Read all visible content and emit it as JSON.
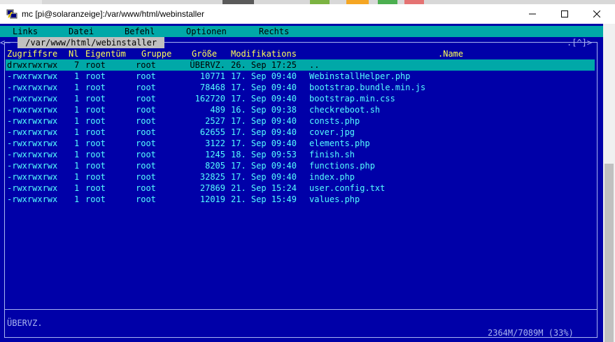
{
  "window": {
    "title": "mc [pi@solaranzeige]:/var/www/html/webinstaller"
  },
  "menu": [
    "Links",
    "Datei",
    "Befehl",
    "Optionen",
    "Rechts"
  ],
  "panel": {
    "path": " /var/www/html/webinstaller ",
    "corner_left": "<─",
    "corner_right": ".[^]>",
    "columns": {
      "perm": "Zugriffsre",
      "nl": "Nl",
      "owner": "Eigentüm",
      "group": "Gruppe",
      "size": "Größe",
      "mtime": "Modifikations",
      "name": ".Name"
    },
    "rows": [
      {
        "perm": "drwxrwxrwx",
        "nl": "7",
        "owner": "root",
        "group": "root",
        "size": "ÜBERVZ.",
        "mtime": "26. Sep 17:25",
        "name": ".."
      },
      {
        "perm": "-rwxrwxrwx",
        "nl": "1",
        "owner": "root",
        "group": "root",
        "size": "10771",
        "mtime": "17. Sep 09:40",
        "name": "WebinstallHelper.php"
      },
      {
        "perm": "-rwxrwxrwx",
        "nl": "1",
        "owner": "root",
        "group": "root",
        "size": "78468",
        "mtime": "17. Sep 09:40",
        "name": "bootstrap.bundle.min.js"
      },
      {
        "perm": "-rwxrwxrwx",
        "nl": "1",
        "owner": "root",
        "group": "root",
        "size": "162720",
        "mtime": "17. Sep 09:40",
        "name": "bootstrap.min.css"
      },
      {
        "perm": "-rwxrwxrwx",
        "nl": "1",
        "owner": "root",
        "group": "root",
        "size": "489",
        "mtime": "16. Sep 09:38",
        "name": "checkreboot.sh"
      },
      {
        "perm": "-rwxrwxrwx",
        "nl": "1",
        "owner": "root",
        "group": "root",
        "size": "2527",
        "mtime": "17. Sep 09:40",
        "name": "consts.php"
      },
      {
        "perm": "-rwxrwxrwx",
        "nl": "1",
        "owner": "root",
        "group": "root",
        "size": "62655",
        "mtime": "17. Sep 09:40",
        "name": "cover.jpg"
      },
      {
        "perm": "-rwxrwxrwx",
        "nl": "1",
        "owner": "root",
        "group": "root",
        "size": "3122",
        "mtime": "17. Sep 09:40",
        "name": "elements.php"
      },
      {
        "perm": "-rwxrwxrwx",
        "nl": "1",
        "owner": "root",
        "group": "root",
        "size": "1245",
        "mtime": "18. Sep 09:53",
        "name": "finish.sh"
      },
      {
        "perm": "-rwxrwxrwx",
        "nl": "1",
        "owner": "root",
        "group": "root",
        "size": "8205",
        "mtime": "17. Sep 09:40",
        "name": "functions.php"
      },
      {
        "perm": "-rwxrwxrwx",
        "nl": "1",
        "owner": "root",
        "group": "root",
        "size": "32825",
        "mtime": "17. Sep 09:40",
        "name": "index.php"
      },
      {
        "perm": "-rwxrwxrwx",
        "nl": "1",
        "owner": "root",
        "group": "root",
        "size": "27869",
        "mtime": "21. Sep 15:24",
        "name": "user.config.txt"
      },
      {
        "perm": "-rwxrwxrwx",
        "nl": "1",
        "owner": "root",
        "group": "root",
        "size": "12019",
        "mtime": "21. Sep 15:49",
        "name": "values.php"
      }
    ],
    "status": "ÜBERVZ.",
    "free_space": "2364M/7089M (33%)"
  },
  "colors": {
    "terminal_bg": "#0000a8",
    "menubar_bg": "#00a8a8",
    "selection_bg": "#00a8a8",
    "file_text": "#55ffff",
    "header_text": "#ffff55",
    "frame": "#a8b4f0"
  },
  "icons": {
    "app": "putty-icon",
    "minimize": "minimize-icon",
    "maximize": "maximize-icon",
    "close": "close-icon"
  }
}
